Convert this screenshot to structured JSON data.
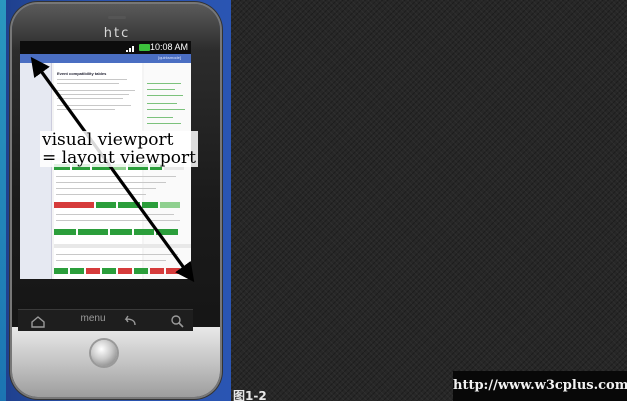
{
  "phone": {
    "brand": "htc",
    "status_time": "10:08 AM",
    "nav_menu_label": "menu"
  },
  "webpage": {
    "title": "Event compatibility tables",
    "header_text": "[quirksmode]"
  },
  "diagram": {
    "label_line_1": "visual viewport",
    "label_line_2": "= layout viewport"
  },
  "caption": "图1-2",
  "watermark": "http://www.w3cplus.com",
  "colors": {
    "page_bg": "#2a55b3",
    "panel_bg": "#272727",
    "arrow": "#000000",
    "cell_green": "#2b9e3b",
    "cell_red": "#d63b3b"
  },
  "icons": [
    "signal-icon",
    "battery-icon",
    "home-icon",
    "back-icon",
    "search-icon",
    "trackball"
  ]
}
